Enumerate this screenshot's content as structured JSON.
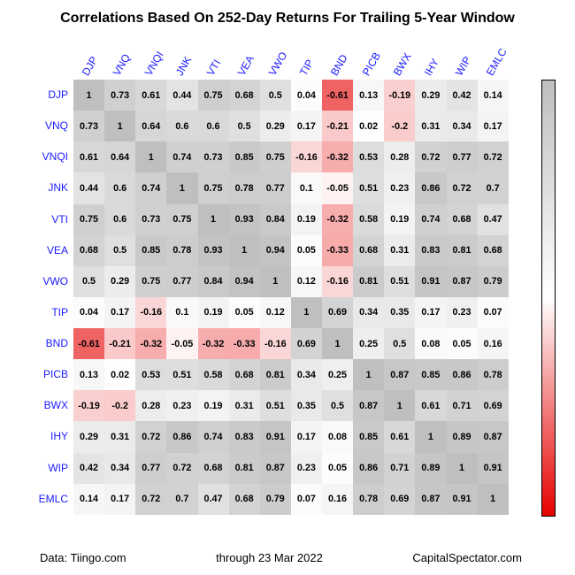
{
  "title": "Correlations Based On 252-Day Returns For Trailing 5-Year Window",
  "footer": {
    "data_source": "Data: Tiingo.com",
    "date": "through 23 Mar 2022",
    "brand": "CapitalSpectator.com"
  },
  "legend_ticks": [
    "1",
    "0.8",
    "0.6",
    "0.4",
    "0.2",
    "0",
    "-0.2",
    "-0.4",
    "-0.6",
    "-0.8",
    "-1"
  ],
  "chart_data": {
    "type": "heatmap",
    "title": "Correlations Based On 252-Day Returns For Trailing 5-Year Window",
    "xlabel": "",
    "ylabel": "",
    "zmin": -1,
    "zmax": 1,
    "categories": [
      "DJP",
      "VNQ",
      "VNQI",
      "JNK",
      "VTI",
      "VEA",
      "VWO",
      "TIP",
      "BND",
      "PICB",
      "BWX",
      "IHY",
      "WIP",
      "EMLC"
    ],
    "matrix": [
      [
        1,
        0.73,
        0.61,
        0.44,
        0.75,
        0.68,
        0.5,
        0.04,
        -0.61,
        0.13,
        -0.19,
        0.29,
        0.42,
        0.14
      ],
      [
        0.73,
        1,
        0.64,
        0.6,
        0.6,
        0.5,
        0.29,
        0.17,
        -0.21,
        0.02,
        -0.2,
        0.31,
        0.34,
        0.17
      ],
      [
        0.61,
        0.64,
        1,
        0.74,
        0.73,
        0.85,
        0.75,
        -0.16,
        -0.32,
        0.53,
        0.28,
        0.72,
        0.77,
        0.72
      ],
      [
        0.44,
        0.6,
        0.74,
        1,
        0.75,
        0.78,
        0.77,
        0.1,
        -0.05,
        0.51,
        0.23,
        0.86,
        0.72,
        0.7
      ],
      [
        0.75,
        0.6,
        0.73,
        0.75,
        1,
        0.93,
        0.84,
        0.19,
        -0.32,
        0.58,
        0.19,
        0.74,
        0.68,
        0.47
      ],
      [
        0.68,
        0.5,
        0.85,
        0.78,
        0.93,
        1,
        0.94,
        0.05,
        -0.33,
        0.68,
        0.31,
        0.83,
        0.81,
        0.68
      ],
      [
        0.5,
        0.29,
        0.75,
        0.77,
        0.84,
        0.94,
        1,
        0.12,
        -0.16,
        0.81,
        0.51,
        0.91,
        0.87,
        0.79
      ],
      [
        0.04,
        0.17,
        -0.16,
        0.1,
        0.19,
        0.05,
        0.12,
        1,
        0.69,
        0.34,
        0.35,
        0.17,
        0.23,
        0.07
      ],
      [
        -0.61,
        -0.21,
        -0.32,
        -0.05,
        -0.32,
        -0.33,
        -0.16,
        0.69,
        1,
        0.25,
        0.5,
        0.08,
        0.05,
        0.16
      ],
      [
        0.13,
        0.02,
        0.53,
        0.51,
        0.58,
        0.68,
        0.81,
        0.34,
        0.25,
        1,
        0.87,
        0.85,
        0.86,
        0.78
      ],
      [
        -0.19,
        -0.2,
        0.28,
        0.23,
        0.19,
        0.31,
        0.51,
        0.35,
        0.5,
        0.87,
        1,
        0.61,
        0.71,
        0.69
      ],
      [
        0.29,
        0.31,
        0.72,
        0.86,
        0.74,
        0.83,
        0.91,
        0.17,
        0.08,
        0.85,
        0.61,
        1,
        0.89,
        0.87
      ],
      [
        0.42,
        0.34,
        0.77,
        0.72,
        0.68,
        0.81,
        0.87,
        0.23,
        0.05,
        0.86,
        0.71,
        0.89,
        1,
        0.91
      ],
      [
        0.14,
        0.17,
        0.72,
        0.7,
        0.47,
        0.68,
        0.79,
        0.07,
        0.16,
        0.78,
        0.69,
        0.87,
        0.91,
        1
      ]
    ]
  }
}
